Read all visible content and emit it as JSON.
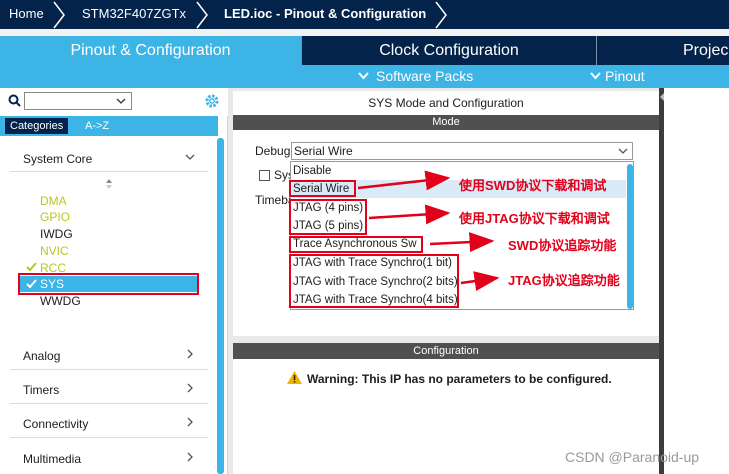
{
  "breadcrumb": {
    "home": "Home",
    "chip": "STM32F407ZGTx",
    "file": "LED.ioc - Pinout & Configuration"
  },
  "tabs": [
    {
      "label": "Pinout & Configuration"
    },
    {
      "label": "Clock Configuration"
    },
    {
      "label": "Projec"
    }
  ],
  "subbar": {
    "software_packs": "Software Packs",
    "pinout": "Pinout"
  },
  "left": {
    "search": {
      "value": ""
    },
    "cat_tabs": [
      "Categories",
      "A->Z"
    ],
    "system_core": "System Core",
    "peripherals": [
      "DMA",
      "GPIO",
      "IWDG",
      "NVIC",
      "RCC",
      "SYS",
      "WWDG"
    ],
    "categories": [
      "Analog",
      "Timers",
      "Connectivity",
      "Multimedia"
    ]
  },
  "panel": {
    "title": "SYS Mode and Configuration",
    "mode": "Mode",
    "debug_label": "Debug",
    "debug_value": "Serial Wire",
    "sys_label": "Sys",
    "timebase_label": "Timeba",
    "options": [
      "Disable",
      "Serial Wire",
      "JTAG (4 pins)",
      "JTAG (5 pins)",
      "Trace Asynchronous Sw",
      "JTAG with Trace Synchro(1 bit)",
      "JTAG with Trace Synchro(2 bits)",
      "JTAG with Trace Synchro(4 bits)"
    ],
    "configuration": "Configuration",
    "warning": "Warning: This IP has no parameters to be configured."
  },
  "annotations": [
    "使用SWD协议下载和调试",
    "使用JTAG协议下载和调试",
    "SWD协议追踪功能",
    "JTAG协议追踪功能"
  ],
  "watermark": "CSDN @Paranoid-up",
  "colors": {
    "navy": "#03234b",
    "accent": "#3cb4e6",
    "highlight": "#e2001a",
    "enabled": "#b9c81e"
  }
}
